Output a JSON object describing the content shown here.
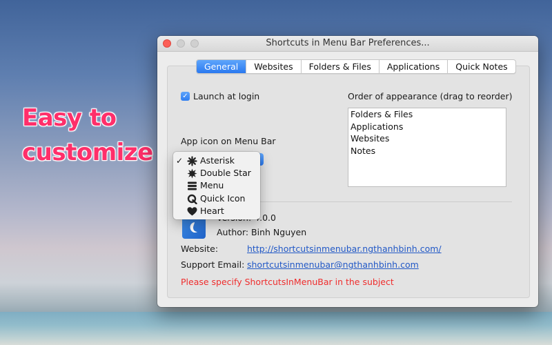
{
  "promo": {
    "line1": "Easy to",
    "line2": "customize"
  },
  "window": {
    "title": "Shortcuts in Menu Bar Preferences..."
  },
  "tabs": [
    {
      "label": "General",
      "active": true
    },
    {
      "label": "Websites",
      "active": false
    },
    {
      "label": "Folders & Files",
      "active": false
    },
    {
      "label": "Applications",
      "active": false
    },
    {
      "label": "Quick Notes",
      "active": false
    }
  ],
  "general": {
    "launch_at_login": {
      "label": "Launch at login",
      "checked": true,
      "check_glyph": "✓"
    },
    "app_icon_label": "App icon on Menu Bar",
    "order_label": "Order of appearance (drag to reorder)",
    "order_items": [
      "Folders & Files",
      "Applications",
      "Websites",
      "Notes"
    ]
  },
  "icon_menu": {
    "check_glyph": "✓",
    "items": [
      {
        "label": "Asterisk",
        "icon": "asterisk-icon",
        "selected": true
      },
      {
        "label": "Double Star",
        "icon": "double-star-icon",
        "selected": false
      },
      {
        "label": "Menu",
        "icon": "menu-icon",
        "selected": false
      },
      {
        "label": "Quick Icon",
        "icon": "quick-icon",
        "selected": false
      },
      {
        "label": "Heart",
        "icon": "heart-icon",
        "selected": false
      }
    ]
  },
  "about": {
    "version": "Version: 4.0.0",
    "author": "Author: Binh Nguyen",
    "website_label": "Website:",
    "website_url": "http://shortcutsinmenubar.ngthanhbinh.com/",
    "support_label": "Support Email:",
    "support_email": "shortcutsinmenubar@ngthanhbinh.com",
    "note": "Please specify ShortcutsInMenuBar in the subject"
  },
  "colors": {
    "accent": "#2a79f0",
    "link": "#2158c6",
    "warning": "#ef2d2d",
    "promo": "#ff2f6a"
  }
}
